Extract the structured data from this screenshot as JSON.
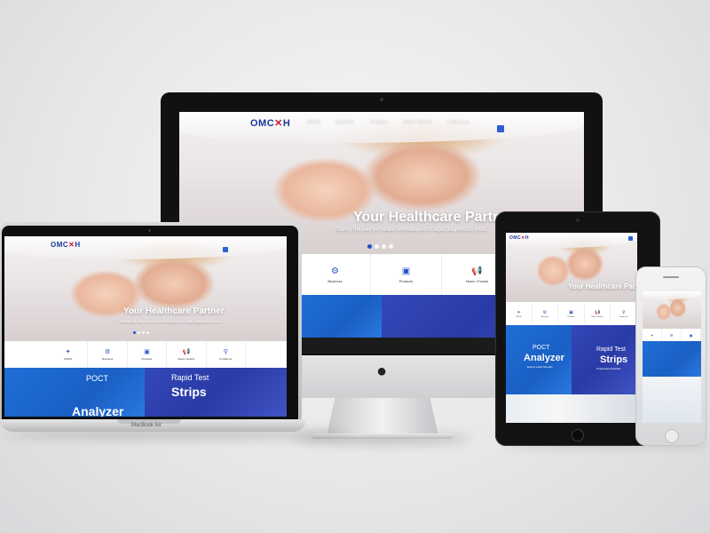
{
  "site": {
    "logo": "OMC",
    "logo_x": "✕",
    "logo_end": "H",
    "nav": [
      "OMCH",
      "Business",
      "Products",
      "News / Events",
      "Contact us"
    ],
    "hero_title": "Your Healthcare Partner",
    "hero_sub": "Paving the way for future technologies of rapid diagnostics tests",
    "quick_links": [
      {
        "label": "OMCH",
        "icon": "globe-icon",
        "glyph": "✦"
      },
      {
        "label": "Business",
        "icon": "people-icon",
        "glyph": "⚙"
      },
      {
        "label": "Products",
        "icon": "monitor-icon",
        "glyph": "▣"
      },
      {
        "label": "News / Events",
        "icon": "megaphone-icon",
        "glyph": "📢"
      },
      {
        "label": "Contact us",
        "icon": "location-pin-icon",
        "glyph": "⚲"
      }
    ],
    "promo_left_small": "POCT",
    "promo_left_big": "Analyzer",
    "promo_left_sub": "Expect Letter Results",
    "promo_right_small": "Rapid Test",
    "promo_right_big": "Strips",
    "promo_right_sub": "Professional Results"
  },
  "laptop": {
    "brand": "MacBook Air"
  },
  "colors": {
    "brand_blue": "#1f4fc9",
    "logo_red": "#c8102e",
    "promo_blue": "#1e6fd6",
    "promo_indigo": "#3348b8"
  }
}
